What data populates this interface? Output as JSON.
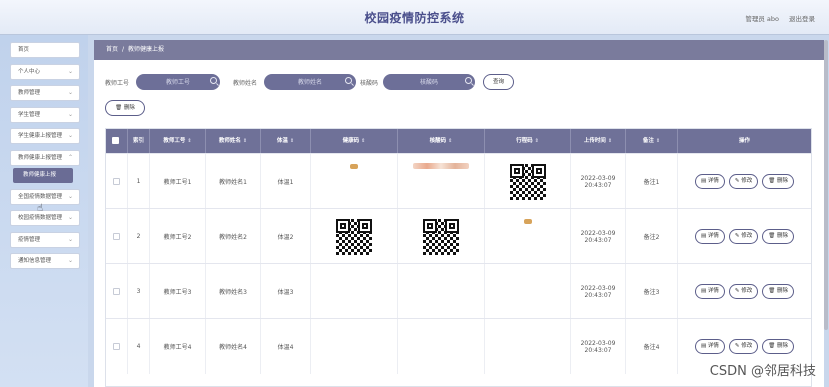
{
  "header": {
    "title": "校园疫情防控系统",
    "user": "管理员 abo",
    "logout": "退出登录"
  },
  "sidebar": {
    "items": [
      {
        "label": "首页",
        "chevron": false
      },
      {
        "label": "个人中心",
        "chevron": true
      },
      {
        "label": "教师管理",
        "chevron": true
      },
      {
        "label": "学生管理",
        "chevron": true
      },
      {
        "label": "学生健康上报管理",
        "chevron": true
      },
      {
        "label": "教师健康上报管理",
        "chevron": true
      },
      {
        "label": "全国疫情数据管理",
        "chevron": true
      },
      {
        "label": "校园疫情数据管理",
        "chevron": true
      },
      {
        "label": "疫情管理",
        "chevron": true
      },
      {
        "label": "通知信息管理",
        "chevron": true
      }
    ],
    "active_sub": "教师健康上报"
  },
  "breadcrumb": {
    "home": "首页",
    "separator": "/",
    "current": "教师健康上报"
  },
  "search": {
    "teacher_id_label": "教师工号",
    "teacher_id_placeholder": "教师工号",
    "teacher_name_label": "教师姓名",
    "teacher_name_placeholder": "教师姓名",
    "nucleic_label": "核酸码",
    "nucleic_placeholder": "核酸码",
    "query_button": "查询"
  },
  "toolbar": {
    "delete_label": "删除",
    "delete_icon": "trash-icon"
  },
  "table": {
    "columns": [
      "索引",
      "教师工号",
      "教师姓名",
      "体温",
      "健康码",
      "核酸码",
      "行程码",
      "上传时间",
      "备注",
      "操作"
    ],
    "sortable": [
      false,
      true,
      true,
      true,
      true,
      true,
      true,
      true,
      true,
      false
    ],
    "rows": [
      {
        "index": "1",
        "teacher_id": "教师工号1",
        "teacher_name": "教师姓名1",
        "temperature": "体温1",
        "health_code": "thumb-small",
        "nucleic_code": "thumb-strip",
        "trip_code": "qr",
        "upload_time": "2022-03-09 20:43:07",
        "note": "备注1"
      },
      {
        "index": "2",
        "teacher_id": "教师工号2",
        "teacher_name": "教师姓名2",
        "temperature": "体温2",
        "health_code": "qr",
        "nucleic_code": "qr",
        "trip_code": "thumb-small",
        "upload_time": "2022-03-09 20:43:07",
        "note": "备注2"
      },
      {
        "index": "3",
        "teacher_id": "教师工号3",
        "teacher_name": "教师姓名3",
        "temperature": "体温3",
        "health_code": "",
        "nucleic_code": "",
        "trip_code": "",
        "upload_time": "2022-03-09 20:43:07",
        "note": "备注3"
      },
      {
        "index": "4",
        "teacher_id": "教师工号4",
        "teacher_name": "教师姓名4",
        "temperature": "体温4",
        "health_code": "",
        "nucleic_code": "",
        "trip_code": "",
        "upload_time": "2022-03-09 20:43:07",
        "note": "备注4"
      }
    ],
    "actions": {
      "detail": "详情",
      "edit": "修改",
      "delete": "删除"
    }
  },
  "watermark": "CSDN @邻居科技"
}
